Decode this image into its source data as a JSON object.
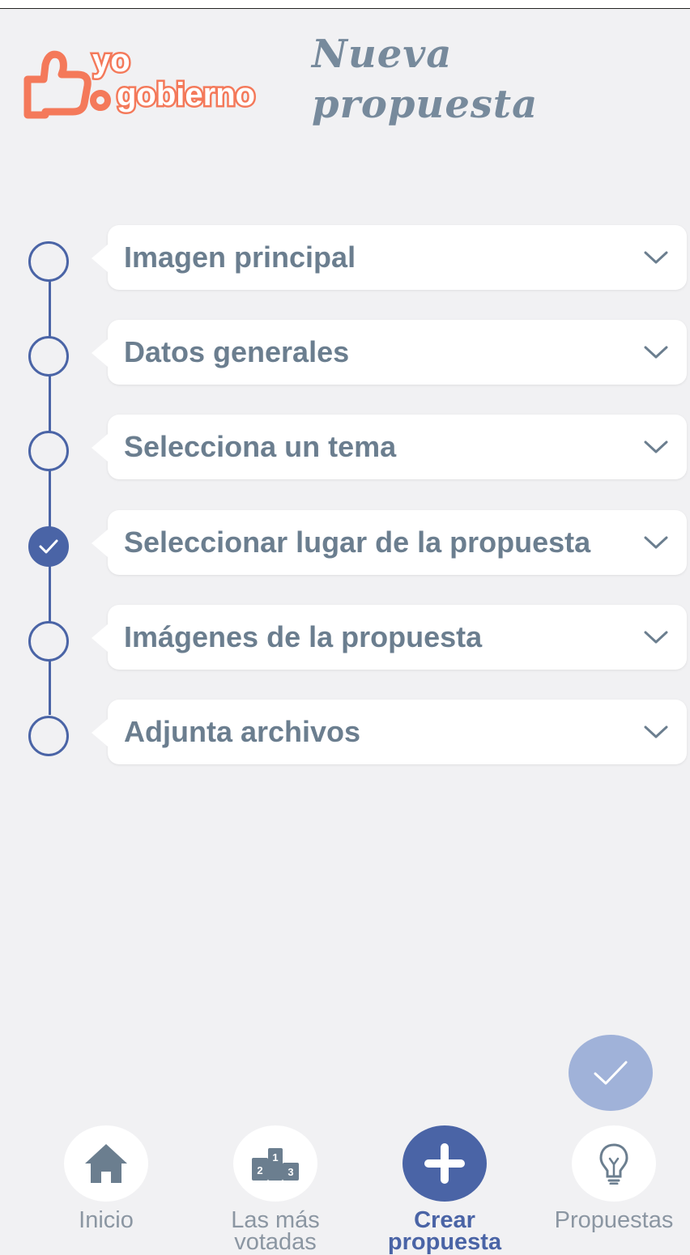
{
  "header": {
    "logo_text": "yo gobierno",
    "title_line1": "Nueva",
    "title_line2": "propuesta"
  },
  "steps": [
    {
      "label": "Imagen principal",
      "completed": false
    },
    {
      "label": "Datos generales",
      "completed": false
    },
    {
      "label": "Selecciona un tema",
      "completed": false
    },
    {
      "label": "Seleccionar lugar de la propuesta",
      "completed": true
    },
    {
      "label": "Imágenes de la propuesta",
      "completed": false
    },
    {
      "label": "Adjunta archivos",
      "completed": false
    }
  ],
  "fab": {
    "icon": "check-icon"
  },
  "nav": {
    "inicio": {
      "label": "Inicio",
      "icon": "home-icon"
    },
    "votadas": {
      "label": "Las más votadas",
      "icon": "podium-icon"
    },
    "crear": {
      "label": "Crear propuesta",
      "icon": "plus-icon"
    },
    "propuestas": {
      "label": "Propuestas",
      "icon": "lightbulb-icon"
    }
  },
  "colors": {
    "accent": "#4a64a6",
    "logo": "#f4795a",
    "title": "#778a9c",
    "fab": "#a0b2d9",
    "background": "#f1f1f3"
  }
}
